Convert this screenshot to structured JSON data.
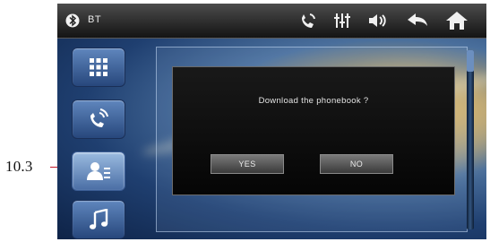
{
  "callout": {
    "label": "10.3"
  },
  "status_bar": {
    "bluetooth_label": "BT"
  },
  "icons": {
    "bluetooth": "bluetooth-icon",
    "call": "call-icon",
    "equalizer": "equalizer-icon",
    "volume": "volume-icon",
    "back": "back-icon",
    "home": "home-icon",
    "menu": "grid-menu-icon",
    "dial": "phone-dial-icon",
    "phonebook": "phonebook-icon",
    "music": "music-icon"
  },
  "sidebar": {
    "items": [
      {
        "name": "menu",
        "active": false
      },
      {
        "name": "dial",
        "active": false
      },
      {
        "name": "phonebook",
        "active": true
      },
      {
        "name": "music",
        "active": false
      }
    ]
  },
  "dialog": {
    "message": "Download the phonebook ?",
    "yes_label": "YES",
    "no_label": "NO"
  },
  "colors": {
    "topbar": "#2a2a2a",
    "button_blue": "#3d64a0",
    "dialog_bg": "#0d0d0d",
    "callout_line": "#c0182a"
  }
}
